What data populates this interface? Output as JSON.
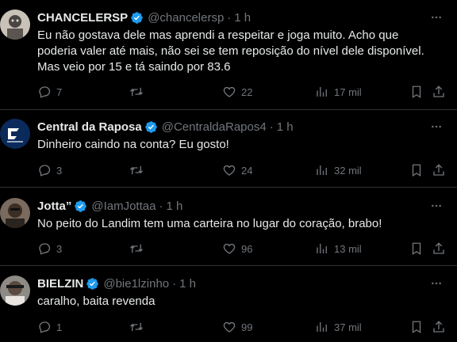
{
  "tweets": [
    {
      "name": "CHANCELERSP",
      "handle": "@chancelersp",
      "dot": "·",
      "time": "1 h",
      "text": "Eu não gostava dele mas aprendi a respeitar e joga muito. Acho que poderia valer até mais, não sei se tem reposição do nível dele disponível. Mas veio por 15 e tá saindo por 83.6",
      "replies": "7",
      "retweets": "",
      "likes": "22",
      "views": "17 mil"
    },
    {
      "name": "Central da Raposa",
      "handle": "@CentraldaRapos4",
      "dot": "·",
      "time": "1 h",
      "text": "Dinheiro caindo na conta? Eu gosto!",
      "replies": "3",
      "retweets": "",
      "likes": "24",
      "views": "32 mil"
    },
    {
      "name": "Jotta”",
      "handle": "@IamJottaa",
      "dot": "·",
      "time": "1 h",
      "text": "No peito do Landim tem uma carteira no lugar do coração, brabo!",
      "replies": "3",
      "retweets": "",
      "likes": "96",
      "views": "13 mil"
    },
    {
      "name": "BIELZIN",
      "handle": "@bie1lzinho",
      "dot": "·",
      "time": "1 h",
      "text": "caralho, baita revenda",
      "replies": "1",
      "retweets": "",
      "likes": "99",
      "views": "37 mil"
    }
  ],
  "colors": {
    "verified": "#1d9bf0",
    "muted": "#71767b",
    "divider": "#2f3336",
    "text": "#e7e9ea"
  },
  "icons": [
    "reply-icon",
    "retweet-icon",
    "like-icon",
    "views-icon",
    "bookmark-icon",
    "share-icon",
    "more-icon",
    "verified-badge-icon"
  ]
}
